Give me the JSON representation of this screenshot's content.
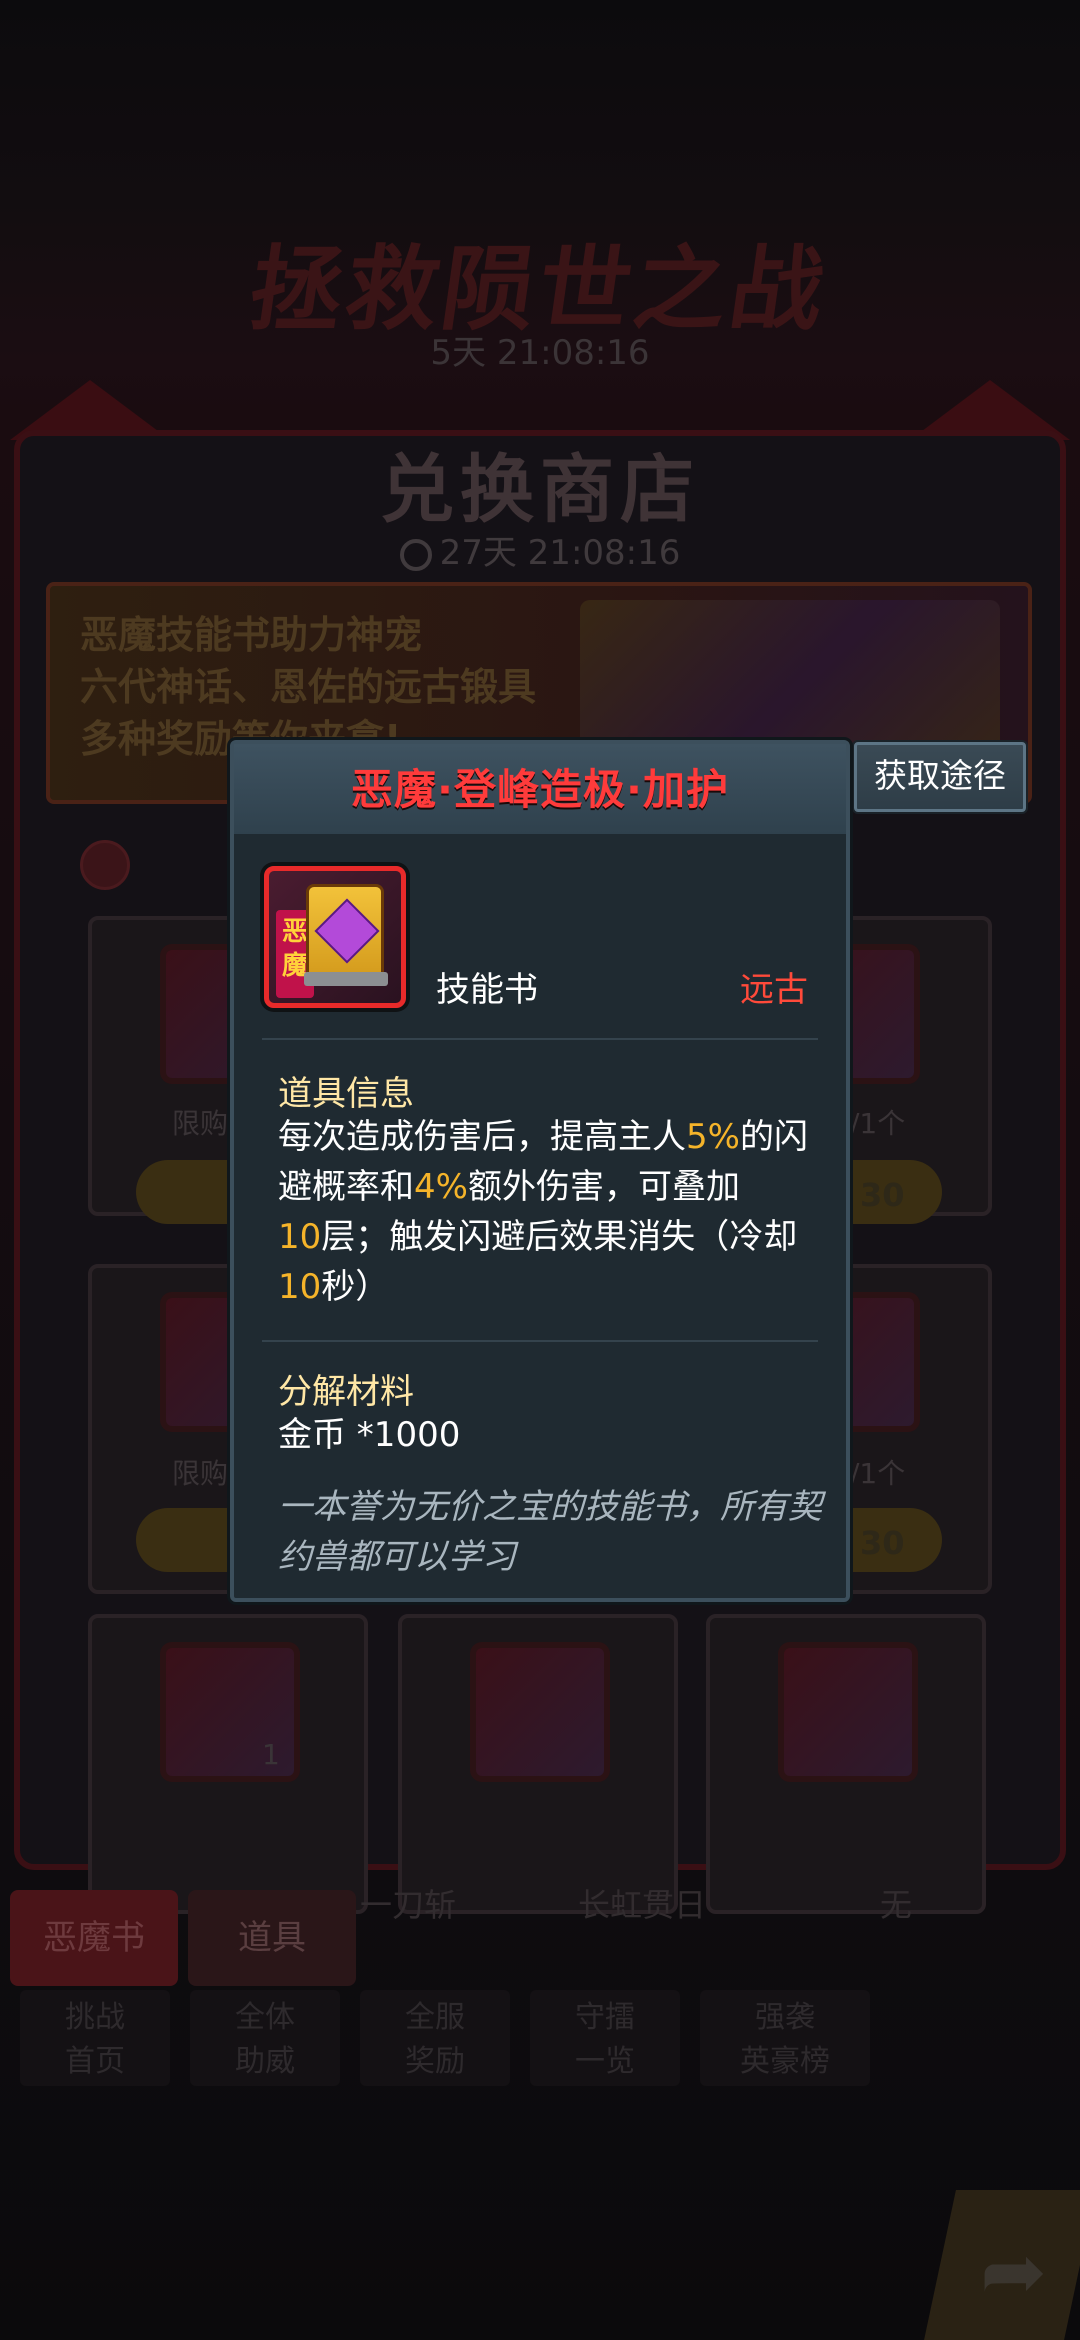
{
  "background": {
    "event_title": "拯救陨世之战",
    "event_timer": "5天 21:08:16",
    "shop_title": "兑换商店",
    "shop_timer": "27天 21:08:16",
    "banner_lines": [
      "恶魔技能书助力神宠",
      "六代神话、恩佐的远古锻具",
      "多种奖励等你来拿!"
    ],
    "grid_labels": [
      "限购1",
      "/1个",
      "限购1",
      "/1个"
    ],
    "prices": [
      "30",
      "30"
    ],
    "stack_count": "1",
    "tabs": [
      "恶魔书",
      "道具"
    ],
    "skill_names": [
      "一刀斩",
      "长虹贯日",
      "无"
    ],
    "nav_buttons": [
      "挑战\n首页",
      "全体\n助威",
      "全服\n奖励",
      "守擂\n一览",
      "强袭\n英豪榜"
    ]
  },
  "acquire_button": "获取途径",
  "popup": {
    "title": "恶魔·登峰造极·加护",
    "item_spine_text": "恶魔",
    "item_type": "技能书",
    "rarity": "远古",
    "info_title": "道具信息",
    "info_lines": [
      [
        "每次造成伤害后，提高主人",
        "5%",
        "的闪"
      ],
      [
        "避概率和",
        "4%",
        "额外伤害，可叠加"
      ],
      [
        "",
        "10",
        "层；触发闪避后效果消失（冷却"
      ],
      [
        "",
        "10",
        "秒）"
      ]
    ],
    "decompose_title": "分解材料",
    "decompose_value": "金币 *1000",
    "flavor_lines": [
      "一本誉为无价之宝的技能书，所有契",
      "约兽都可以学习"
    ]
  },
  "colors": {
    "title_red": "#ff3b3b",
    "highlight_gold": "#f5b42a",
    "section_cream": "#ffe7a6",
    "popup_bg": "#1f2a31"
  }
}
